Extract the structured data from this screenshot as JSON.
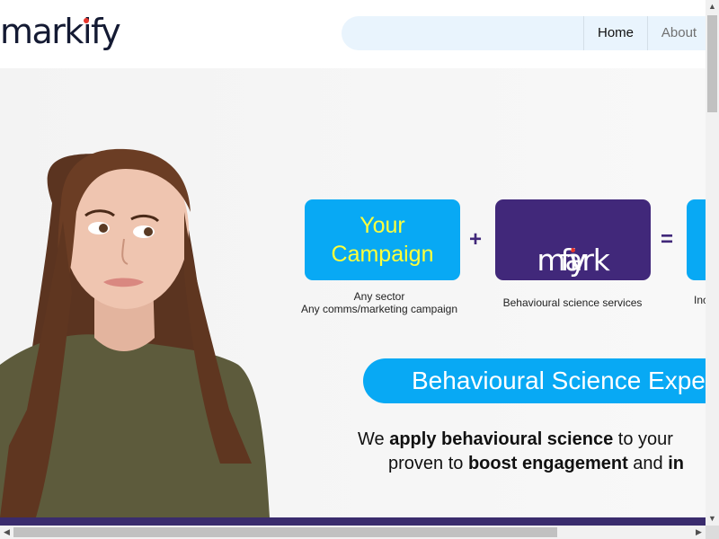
{
  "header": {
    "logo_parts": [
      "mark",
      "i",
      "fy"
    ],
    "nav": [
      {
        "label": "Home"
      },
      {
        "label": "About"
      }
    ]
  },
  "hero": {
    "campaign_box": {
      "line1": "Your",
      "line2": "Campaign"
    },
    "plus": "+",
    "markify_box": {
      "parts": [
        "mark",
        "i",
        "fy"
      ]
    },
    "equals": "=",
    "captions": {
      "campaign_line1": "Any sector",
      "campaign_line2": "Any comms/marketing campaign",
      "markify": "Behavioural science services",
      "result": "Inc"
    },
    "pill_text": "Behavioural Science Expe",
    "tagline1": {
      "pre": "We ",
      "bold": "apply behavioural science",
      "post": " to your"
    },
    "tagline2": {
      "pre": "proven to ",
      "bold": "boost engagement",
      "mid": " and ",
      "bold2": "in"
    }
  },
  "colors": {
    "brand_purple": "#41287a",
    "brand_blue": "#08a9f4",
    "campaign_text": "#ffff3a",
    "nav_bg": "#e9f4fd"
  },
  "scrollbar_arrows": {
    "up": "▲",
    "down": "▼",
    "left": "◀",
    "right": "▶"
  }
}
